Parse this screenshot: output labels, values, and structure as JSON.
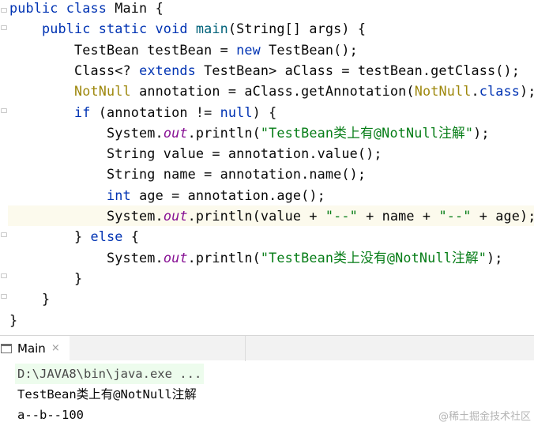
{
  "editor": {
    "lines": [
      {
        "tokens": [
          {
            "t": "public class ",
            "c": "kw"
          },
          {
            "t": "Main {",
            "c": ""
          }
        ]
      },
      {
        "tokens": [
          {
            "t": "    public static void ",
            "c": "kw"
          },
          {
            "t": "main",
            "c": "fn"
          },
          {
            "t": "(String[] args) {",
            "c": ""
          }
        ]
      },
      {
        "tokens": [
          {
            "t": "        TestBean testBean = ",
            "c": ""
          },
          {
            "t": "new ",
            "c": "kw"
          },
          {
            "t": "TestBean();",
            "c": ""
          }
        ]
      },
      {
        "tokens": [
          {
            "t": "        Class<? ",
            "c": ""
          },
          {
            "t": "extends ",
            "c": "kw"
          },
          {
            "t": "TestBean> aClass = testBean.getClass();",
            "c": ""
          }
        ]
      },
      {
        "tokens": [
          {
            "t": "        ",
            "c": ""
          },
          {
            "t": "NotNull",
            "c": "ann"
          },
          {
            "t": " annotation = aClass.getAnnotation(",
            "c": ""
          },
          {
            "t": "NotNull",
            "c": "ann"
          },
          {
            "t": ".",
            "c": ""
          },
          {
            "t": "class",
            "c": "kw"
          },
          {
            "t": ");",
            "c": ""
          }
        ]
      },
      {
        "tokens": [
          {
            "t": "        ",
            "c": ""
          },
          {
            "t": "if ",
            "c": "kw"
          },
          {
            "t": "(annotation != ",
            "c": ""
          },
          {
            "t": "null",
            "c": "kw"
          },
          {
            "t": ") {",
            "c": ""
          }
        ]
      },
      {
        "tokens": [
          {
            "t": "            System.",
            "c": ""
          },
          {
            "t": "out",
            "c": "st"
          },
          {
            "t": ".println(",
            "c": ""
          },
          {
            "t": "\"TestBean类上有@NotNull注解\"",
            "c": "str"
          },
          {
            "t": ");",
            "c": ""
          }
        ]
      },
      {
        "tokens": [
          {
            "t": "            String value = annotation.value();",
            "c": ""
          }
        ]
      },
      {
        "tokens": [
          {
            "t": "            String name = annotation.name();",
            "c": ""
          }
        ]
      },
      {
        "tokens": [
          {
            "t": "            ",
            "c": ""
          },
          {
            "t": "int ",
            "c": "kw"
          },
          {
            "t": "age = annotation.age();",
            "c": ""
          }
        ]
      },
      {
        "tokens": [
          {
            "t": "            System.",
            "c": ""
          },
          {
            "t": "out",
            "c": "st"
          },
          {
            "t": ".println(value + ",
            "c": ""
          },
          {
            "t": "\"--\"",
            "c": "str"
          },
          {
            "t": " + name + ",
            "c": ""
          },
          {
            "t": "\"--\"",
            "c": "str"
          },
          {
            "t": " + age);",
            "c": ""
          }
        ],
        "caret": true
      },
      {
        "tokens": [
          {
            "t": "        } ",
            "c": ""
          },
          {
            "t": "else ",
            "c": "kw"
          },
          {
            "t": "{",
            "c": ""
          }
        ]
      },
      {
        "tokens": [
          {
            "t": "            System.",
            "c": ""
          },
          {
            "t": "out",
            "c": "st"
          },
          {
            "t": ".println(",
            "c": ""
          },
          {
            "t": "\"TestBean类上没有@NotNull注解\"",
            "c": "str"
          },
          {
            "t": ");",
            "c": ""
          }
        ]
      },
      {
        "tokens": [
          {
            "t": "        }",
            "c": ""
          }
        ]
      },
      {
        "tokens": [
          {
            "t": "    }",
            "c": ""
          }
        ]
      },
      {
        "tokens": [
          {
            "t": "}",
            "c": ""
          }
        ]
      }
    ]
  },
  "run_panel": {
    "tab_label": "Main",
    "close_glyph": "×",
    "output": [
      "D:\\JAVA8\\bin\\java.exe ...",
      "TestBean类上有@NotNull注解",
      "a--b--100"
    ]
  },
  "watermark": "@稀土掘金技术社区",
  "colors": {
    "keyword": "#0033b3",
    "method": "#00627a",
    "string": "#067d17",
    "annotation": "#9e880d",
    "static_field": "#871094",
    "caret_row": "#fcfaed"
  }
}
